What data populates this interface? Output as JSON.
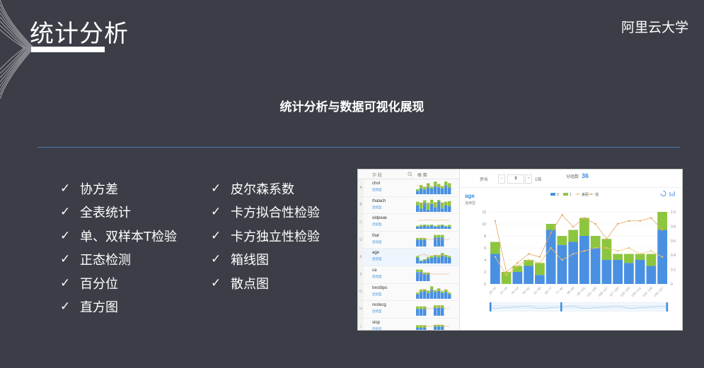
{
  "slide": {
    "title": "统计分析",
    "brand": "阿里云大学",
    "subtitle": "统计分析与数据可视化展现",
    "check_mark": "✓"
  },
  "features_left": [
    "协方差",
    "全表统计",
    "单、双样本T检验",
    "正态检测",
    "百分位",
    "直方图"
  ],
  "features_right": [
    "皮尔森系数",
    "卡方拟合性检验",
    "卡方独立性检验",
    "箱线图",
    "散点图"
  ],
  "screenshot": {
    "left_panel": {
      "header_field": "字 段",
      "header_icon": "search-icon",
      "header_chart": "概 赛",
      "rows": [
        {
          "letter": "A",
          "name": "chol",
          "type": "连续型",
          "selected": false
        },
        {
          "letter": "B",
          "name": "thalach",
          "type": "连续型",
          "selected": false
        },
        {
          "letter": "C",
          "name": "oldpeak",
          "type": "连续型",
          "selected": false
        },
        {
          "letter": "D",
          "name": "thal",
          "type": "连续型",
          "selected": false
        },
        {
          "letter": "E",
          "name": "age",
          "type": "连续型",
          "selected": true
        },
        {
          "letter": "F",
          "name": "ca",
          "type": "连续型",
          "selected": false
        },
        {
          "letter": "G",
          "name": "trestbps",
          "type": "连续型",
          "selected": false
        },
        {
          "letter": "H",
          "name": "restecg",
          "type": "连续型",
          "selected": false
        },
        {
          "letter": "I",
          "name": "slop",
          "type": "连续型",
          "selected": false
        }
      ]
    },
    "toolbar": {
      "step_label": "步长",
      "minus": "−",
      "step_value": "8",
      "plus": "+",
      "unit": "1倍",
      "bins_label": "分组数",
      "bins_value": "36"
    },
    "chart_title": "age",
    "chart_subtitle": "连续型",
    "legend": [
      "0",
      "1",
      "差距",
      "值"
    ],
    "colors": {
      "blue": "#4a90e2",
      "green": "#8cc63f",
      "orange": "#e8a35b",
      "accent": "#3b8de0"
    },
    "chart_data": {
      "type": "bar",
      "title": "age",
      "categories": [
        "29~37",
        "37~45",
        "45~53",
        "53~61",
        "61~69",
        "69~77",
        "77~85",
        "85~93",
        "93~101",
        "101~109",
        "109~117",
        "117~125",
        "125~133",
        "133~141",
        "141~149",
        "149~157"
      ],
      "series": [
        {
          "name": "0",
          "values": [
            5,
            0,
            2,
            3,
            1.5,
            9,
            6.5,
            7,
            8,
            6,
            4,
            4,
            3.5,
            4,
            3,
            9
          ]
        },
        {
          "name": "1",
          "values": [
            2,
            2,
            1,
            1,
            2,
            1,
            1.5,
            2,
            3,
            2,
            3.5,
            1,
            1.5,
            1,
            2,
            3
          ]
        },
        {
          "name": "差距",
          "values": [
            4.5,
            1.5,
            3,
            4,
            3.5,
            6,
            4,
            5,
            5.5,
            6,
            6,
            5.5,
            6,
            5,
            5.5,
            4.5
          ]
        },
        {
          "name": "值",
          "values": [
            10.5,
            2,
            3.5,
            5,
            4.5,
            8.5,
            11.5,
            9.5,
            11,
            10,
            7.5,
            10,
            10.5,
            10.5,
            11,
            9
          ]
        }
      ],
      "ylim": [
        0,
        12
      ],
      "y_ticks": [
        0,
        2,
        4,
        6,
        8,
        10,
        12
      ],
      "y2_ticks": [
        "0",
        "0.2",
        "0.4",
        "0.6",
        "0.8",
        "1.0"
      ],
      "legend_position": "top-right"
    }
  }
}
